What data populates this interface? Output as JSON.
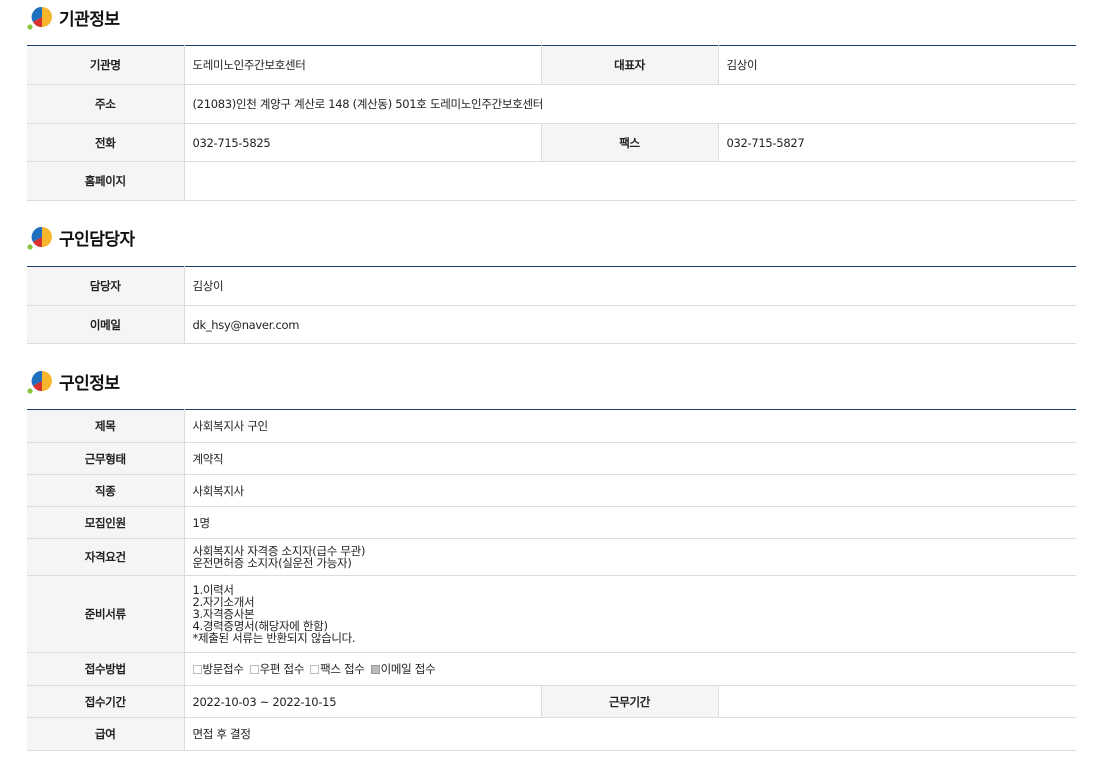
{
  "sections": {
    "org": {
      "title": "기관정보",
      "labels": {
        "name": "기관명",
        "rep": "대표자",
        "address": "주소",
        "phone": "전화",
        "fax": "팩스",
        "homepage": "홈페이지"
      },
      "values": {
        "name": "도레미노인주간보호센터",
        "rep": "김상이",
        "address": "(21083)인천 계양구 계산로 148 (계산동) 501호 도레미노인주간보호센터",
        "phone": "032-715-5825",
        "fax": "032-715-5827",
        "homepage": ""
      }
    },
    "contact": {
      "title": "구인담당자",
      "labels": {
        "manager": "담당자",
        "email": "이메일"
      },
      "values": {
        "manager": "김상이",
        "email": "dk_hsy@naver.com"
      }
    },
    "job": {
      "title": "구인정보",
      "labels": {
        "subject": "제목",
        "work_type": "근무형태",
        "occupation": "직종",
        "headcount": "모집인원",
        "qualifications": "자격요건",
        "documents": "준비서류",
        "apply_method": "접수방법",
        "apply_period": "접수기간",
        "work_period": "근무기간",
        "salary": "급여"
      },
      "values": {
        "subject": "사회복지사 구인",
        "work_type": "계약직",
        "occupation": "사회복지사",
        "headcount": "1명",
        "qualifications": [
          "사회복지사 자격증 소지자(급수 무관)",
          "운전면허증 소지자(실운전 가능자)"
        ],
        "documents": [
          "1.이력서",
          "2.자기소개서",
          "3.자격증사본",
          "4.경력증명서(해당자에 한함)",
          "*제출된 서류는 반환되지 않습니다."
        ],
        "apply_methods": [
          {
            "label": "방문접수",
            "checked": false
          },
          {
            "label": "우편 접수",
            "checked": false
          },
          {
            "label": "팩스 접수",
            "checked": false
          },
          {
            "label": "이메일 접수",
            "checked": true
          }
        ],
        "apply_period": "2022-10-03 ~ 2022-10-15",
        "work_period": "",
        "salary": "면접 후 결정"
      }
    }
  },
  "colors": {
    "header_line": "#1d3d6b",
    "label_bg": "#f5f5f5",
    "border": "#dcdcdc"
  },
  "icons": {
    "section": "colorful-circle-logo-icon"
  }
}
